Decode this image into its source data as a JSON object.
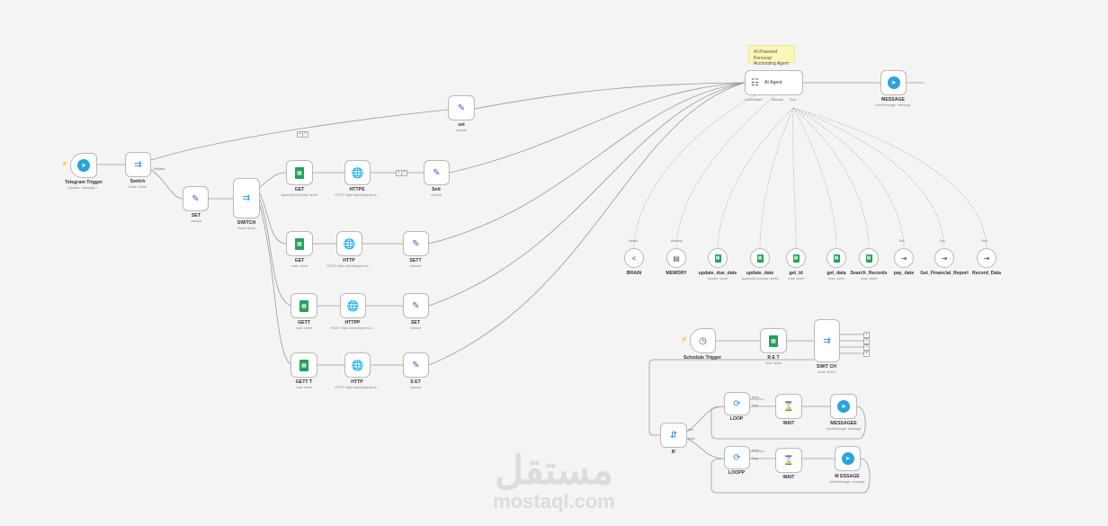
{
  "note": {
    "line1": "AI-Powered Personal",
    "line2": "Accounting Agent"
  },
  "agent": {
    "label": "AI Agent",
    "ports": {
      "chat": "Chat Model*",
      "memory": "Memory",
      "tool": "Tool"
    }
  },
  "nodes": {
    "telegram_trigger": {
      "label": "Telegram Trigger",
      "sub": "Updates: message,f..."
    },
    "switch1": {
      "label": "Switch",
      "sub": "mode: Rules",
      "out_label": "0 | ...",
      "out2": "Fallback"
    },
    "set1": {
      "label": "SET",
      "sub": "manual"
    },
    "set_top": {
      "label": "set",
      "sub": "manual"
    },
    "switch2": {
      "label": "SWITCH",
      "sub": "mode: Rules"
    },
    "get_a": {
      "label": "GET",
      "sub": "append(Or)Update: sheet"
    },
    "http_a": {
      "label": "HTTPS",
      "sub": "POST: https://api.telegram.or..."
    },
    "set_a": {
      "label": "Sett",
      "sub": "manual"
    },
    "get_b": {
      "label": "GET",
      "sub": "read: sheet"
    },
    "http_b": {
      "label": "HTTP",
      "sub": "POST: https://api.telegram.or..."
    },
    "set_b": {
      "label": "SETT",
      "sub": "manual"
    },
    "get_c": {
      "label": "GETT",
      "sub": "read: sheet"
    },
    "http_c": {
      "label": "HTTPP",
      "sub": "POST: https://api.telegram.or..."
    },
    "set_c": {
      "label": "SET",
      "sub": "manual"
    },
    "get_d": {
      "label": "GETT T",
      "sub": "read: sheet"
    },
    "http_d": {
      "label": "HTTP",
      "sub": "POST: https://api.telegram.or..."
    },
    "set_d": {
      "label": "S ET",
      "sub": "manual"
    },
    "message_top": {
      "label": "MESSAGE",
      "sub": "sendMessage: message"
    },
    "schedule": {
      "label": "Schedule Trigger",
      "sub": ""
    },
    "ret": {
      "label": "R E T",
      "sub": "read: sheet"
    },
    "switch3": {
      "label": "SWIT CH",
      "sub": "mode: Rules"
    },
    "if": {
      "label": "IF",
      "sub": "",
      "t": "true",
      "f": "false"
    },
    "loop": {
      "label": "LOOP",
      "sub": "",
      "d": "done",
      "l": "loop"
    },
    "wait1": {
      "label": "WAIT",
      "sub": ""
    },
    "msg1": {
      "label": "MESSAGEE",
      "sub": "sendMessage: message"
    },
    "loopp": {
      "label": "LOOPP",
      "sub": "",
      "d": "done",
      "l": "loop"
    },
    "wait2": {
      "label": "WAIT",
      "sub": ""
    },
    "msg2": {
      "label": "M ESSAGE",
      "sub": "sendMessage: message"
    }
  },
  "subnodes": [
    {
      "port": "Model",
      "label": "BRAIN",
      "sub": ""
    },
    {
      "port": "Memory",
      "label": "MEMORY",
      "sub": ""
    },
    {
      "port": "",
      "label": "update_due_date",
      "sub": "update: sheet"
    },
    {
      "port": "",
      "label": "update_date",
      "sub": "append(Or)Update: sheet"
    },
    {
      "port": "",
      "label": "get_id",
      "sub": "read: sheet"
    },
    {
      "port": "",
      "label": "get_data",
      "sub": "read: sheet"
    },
    {
      "port": "",
      "label": "Search_Records",
      "sub": "read: sheet"
    },
    {
      "port": "Tool",
      "label": "pay_date",
      "sub": ""
    },
    {
      "port": "Tool",
      "label": "Get_Financial_Report",
      "sub": ""
    },
    {
      "port": "Tool",
      "label": "Record_Data",
      "sub": ""
    }
  ],
  "watermark": {
    "arabic": "مستقل",
    "latin": "mostaql.com"
  },
  "icons": {
    "telegram": "telegram-icon",
    "sheets": "google-sheets-icon",
    "http": "globe-icon",
    "set": "pencil-icon",
    "switch": "switch-icon",
    "agent": "robot-icon",
    "clock": "clock-icon",
    "loop": "loop-icon",
    "wait": "hourglass-icon",
    "if": "if-icon",
    "brain": "brain-icon",
    "memory": "database-icon",
    "tool": "workflow-tool-icon"
  }
}
